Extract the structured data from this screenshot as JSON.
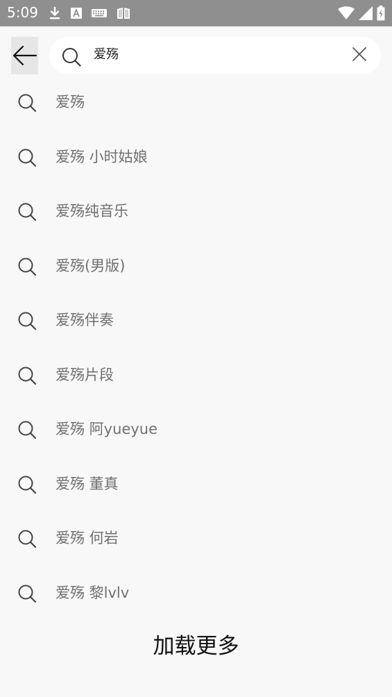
{
  "status_bar": {
    "time": "5:09",
    "left_icons": [
      "download-icon",
      "a-badge-icon",
      "keyboard-icon",
      "book-icon"
    ],
    "right_icons": [
      "wifi-icon",
      "signal-icon",
      "battery-icon"
    ]
  },
  "search": {
    "query": "爱殇",
    "icons": {
      "search": "search-icon",
      "clear": "close-icon",
      "back": "back-arrow-icon"
    }
  },
  "suggestions": [
    "爱殇",
    "爱殇 小时姑娘",
    "爱殇纯音乐",
    "爱殇(男版)",
    "爱殇伴奏",
    "爱殇片段",
    "爱殇 阿yueyue",
    "爱殇 董真",
    "爱殇 何岩",
    "爱殇 黎lvlv"
  ],
  "load_more_label": "加载更多",
  "colors": {
    "status_bar": "#8f8f8f",
    "background": "#f8f8f8",
    "search_box": "#ffffff",
    "suggestion_text": "#707070"
  }
}
